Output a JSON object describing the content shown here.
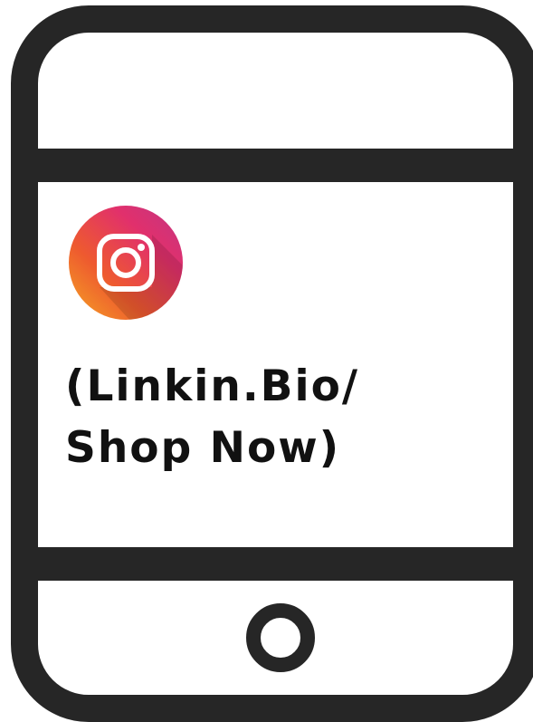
{
  "graphic": {
    "logo_icon": "instagram-icon",
    "line_1": "(Linkin.Bio/",
    "line_2": "Shop Now)"
  },
  "colors": {
    "outline": "#262626",
    "text": "#111111",
    "logo_gradient": [
      "#f39c2c",
      "#e1306c",
      "#b6207a"
    ]
  }
}
